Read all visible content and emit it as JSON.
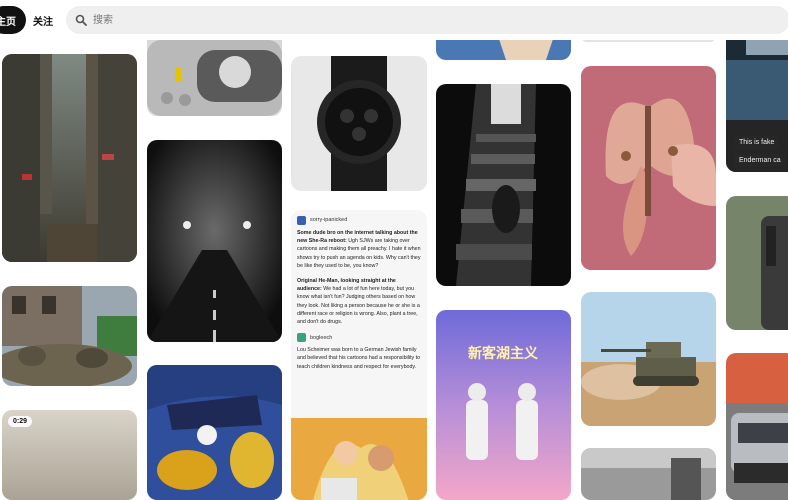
{
  "topbar": {
    "home_tab": "主页",
    "follow_tab": "关注",
    "search_placeholder": "搜索"
  },
  "pins": {
    "video_duration": "0:29",
    "image_text": "新客湖主义",
    "comment_chips": [
      "This is fake",
      "Enderman ca"
    ]
  },
  "text_pin": {
    "user1": "sorry-ipanicked",
    "post1_bold": "Some dude bro on the internet talking about the new She-Ra reboot:",
    "post1_rest": "Ugh SJWs are taking over cartoons and making them all preachy. I hate it when shows try to push an agenda on kids. Why can't they be like they used to be, you know?",
    "post2_bold": "Original He-Man, looking straight at the audience:",
    "post2_rest": "We had a lot of fun here today, but you know what isn't fun? Judging others based on how they look. Not liking a person because he or she is a different race or religion is wrong. Also, plant a tree, and don't do drugs.",
    "user2": "bogleech",
    "post3": "Lou Scheimer was born to a German Jewish family and believed that his cartoons had a responsibility to teach children kindness and respect for everybody."
  }
}
